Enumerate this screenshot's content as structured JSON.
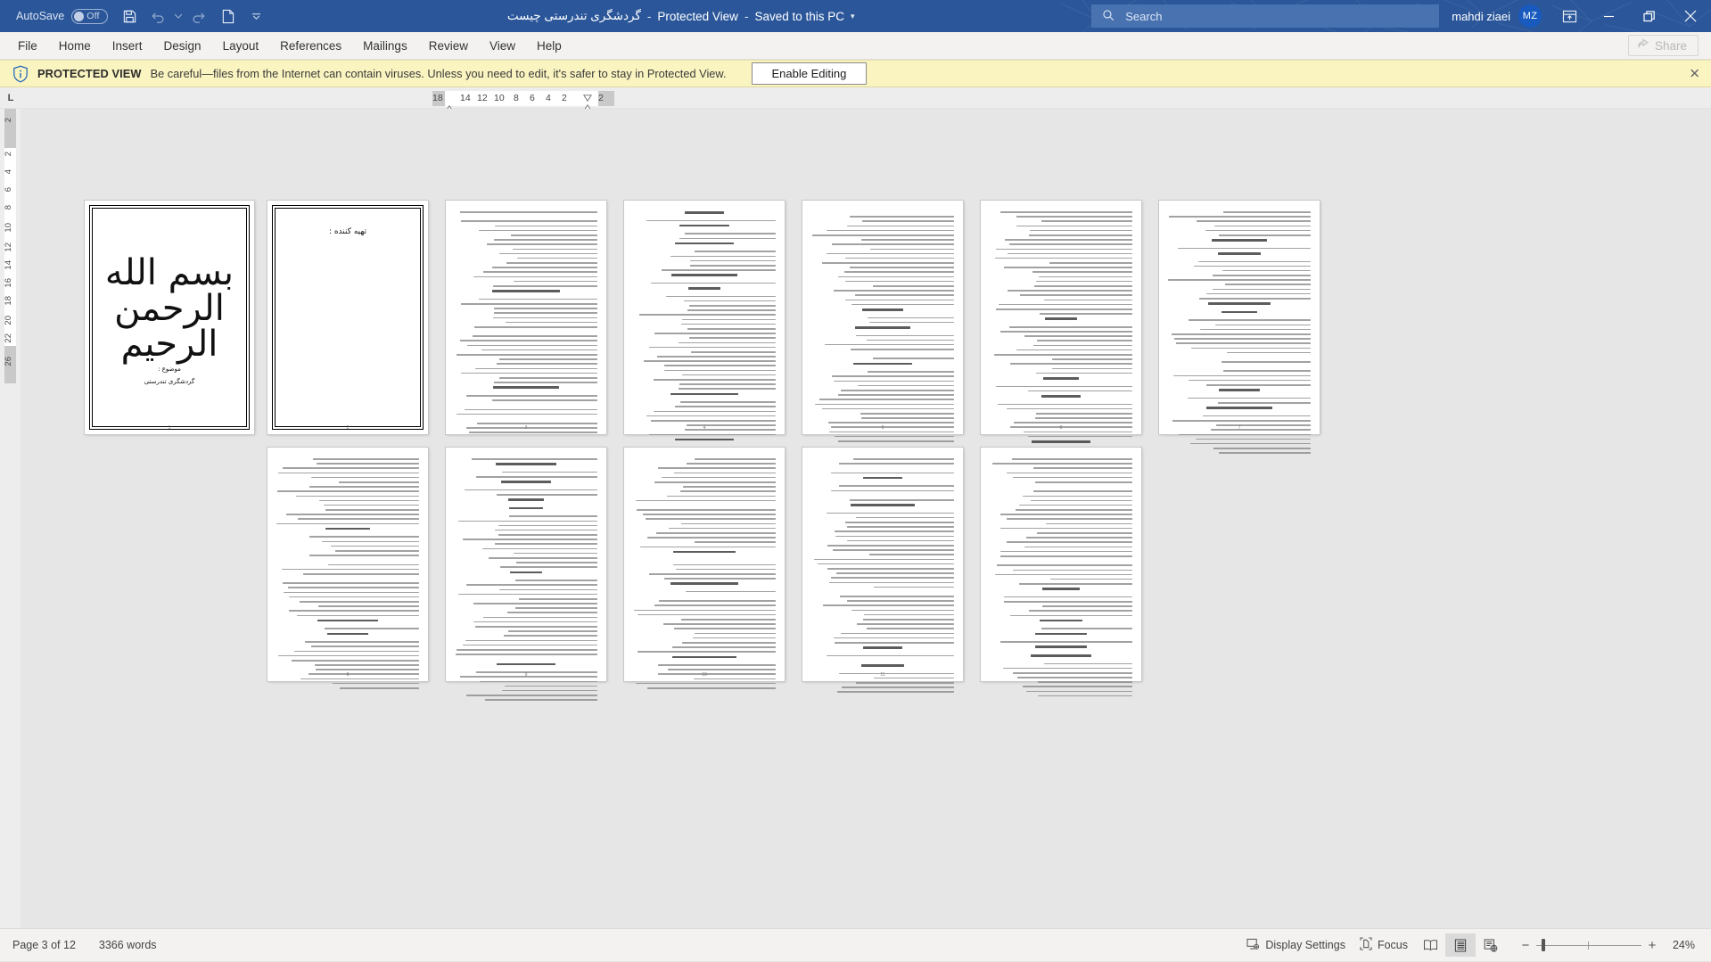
{
  "titlebar": {
    "autosave_label": "AutoSave",
    "autosave_state": "Off",
    "save_icon": "save-icon",
    "undo_icon": "undo-icon",
    "redo_icon": "redo-icon",
    "new_icon": "new-document-icon",
    "customize_icon": "chevron-down-icon",
    "doc_title": "گردشگری تندرستی چیست",
    "sep1": "-",
    "protected_view": "Protected View",
    "sep2": "-",
    "saved_state": "Saved to this PC",
    "title_caret": "▾",
    "search_placeholder": "Search",
    "search_icon": "search-icon",
    "account_name": "mahdi ziaei",
    "account_initials": "MZ",
    "ribbon_display_icon": "ribbon-display-options-icon",
    "minimize_icon": "minimize-icon",
    "restore_icon": "restore-icon",
    "close_icon": "close-icon",
    "accent_color": "#2b579a",
    "avatar_color": "#185abd"
  },
  "ribbon": {
    "tabs": [
      {
        "label": "File"
      },
      {
        "label": "Home"
      },
      {
        "label": "Insert"
      },
      {
        "label": "Design"
      },
      {
        "label": "Layout"
      },
      {
        "label": "References"
      },
      {
        "label": "Mailings"
      },
      {
        "label": "Review"
      },
      {
        "label": "View"
      },
      {
        "label": "Help"
      }
    ],
    "share_label": "Share",
    "share_icon": "share-icon",
    "share_disabled": true
  },
  "protected_view": {
    "shield_icon": "info-shield-icon",
    "strong_label": "PROTECTED VIEW",
    "message": "Be careful—files from the Internet can contain viruses. Unless you need to edit, it's safer to stay in Protected View.",
    "enable_button": "Enable Editing",
    "close_icon": "✕",
    "bar_color": "#faf4c0"
  },
  "ruler": {
    "tabstop_label": "L",
    "horizontal_ticks": [
      "18",
      "14",
      "12",
      "10",
      "8",
      "6",
      "4",
      "2",
      "2"
    ],
    "vertical_ticks_grey_top": "2",
    "vertical_ticks": [
      "2",
      "4",
      "6",
      "8",
      "10",
      "12",
      "14",
      "16",
      "18",
      "20",
      "22"
    ],
    "vertical_ticks_grey_bottom": "26"
  },
  "document": {
    "pages": [
      {
        "id": "page-1",
        "type": "cover",
        "bismillah": "بسم الله الرحمن الرحیم",
        "subject_label": "موضوع :",
        "subject_value": "گردشگری تندرستی",
        "page_number": "1"
      },
      {
        "id": "page-2",
        "type": "title",
        "title": "تهیه کننده :",
        "page_number": "2"
      },
      {
        "id": "page-3",
        "type": "text",
        "page_number": "3"
      },
      {
        "id": "page-4",
        "type": "text",
        "page_number": "4"
      },
      {
        "id": "page-5",
        "type": "text",
        "page_number": "5"
      },
      {
        "id": "page-6",
        "type": "text",
        "page_number": "6"
      },
      {
        "id": "page-7",
        "type": "text",
        "page_number": "7"
      },
      {
        "id": "page-8",
        "type": "text",
        "page_number": "8"
      },
      {
        "id": "page-9",
        "type": "text",
        "page_number": "9"
      },
      {
        "id": "page-10",
        "type": "text",
        "page_number": "10"
      },
      {
        "id": "page-11",
        "type": "text",
        "page_number": "11"
      }
    ]
  },
  "statusbar": {
    "page_indicator": "Page 3 of 12",
    "word_count": "3366 words",
    "display_settings_label": "Display Settings",
    "display_settings_icon": "display-settings-icon",
    "focus_label": "Focus",
    "focus_icon": "focus-icon",
    "read_mode_icon": "read-mode-icon",
    "print_layout_icon": "print-layout-icon",
    "web_layout_icon": "web-layout-icon",
    "active_view": "print-layout",
    "zoom_out": "−",
    "zoom_in": "+",
    "zoom_level": "24%"
  }
}
